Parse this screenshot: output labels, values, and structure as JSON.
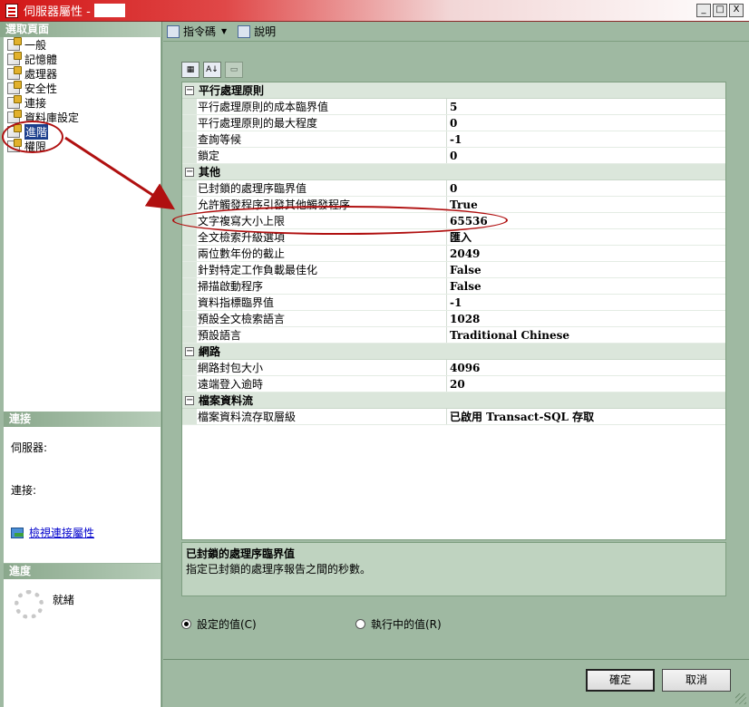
{
  "window": {
    "title": "伺服器屬性 -",
    "buttons": [
      "_",
      "□",
      "X"
    ]
  },
  "left": {
    "select_page_header": "選取頁面",
    "pages": [
      {
        "label": "一般",
        "selected": false
      },
      {
        "label": "記憶體",
        "selected": false
      },
      {
        "label": "處理器",
        "selected": false
      },
      {
        "label": "安全性",
        "selected": false
      },
      {
        "label": "連接",
        "selected": false
      },
      {
        "label": "資料庫設定",
        "selected": false
      },
      {
        "label": "進階",
        "selected": true
      },
      {
        "label": "權限",
        "selected": false
      }
    ],
    "connection_header": "連接",
    "server_label": "伺服器:",
    "connection_label": "連接:",
    "view_conn_link": "檢視連接屬性",
    "progress_header": "進度",
    "progress_status": "就緒"
  },
  "toolbar": {
    "script_label": "指令碼",
    "help_label": "說明"
  },
  "grid_toolbar": {
    "categorized": "▦",
    "alphabetical": "A↓",
    "property_pages": "▭"
  },
  "grid": {
    "categories": [
      {
        "name": "平行處理原則",
        "props": [
          {
            "name": "平行處理原則的成本臨界值",
            "value": "5"
          },
          {
            "name": "平行處理原則的最大程度",
            "value": "0"
          },
          {
            "name": "查詢等候",
            "value": "-1"
          },
          {
            "name": "鎖定",
            "value": "0"
          }
        ]
      },
      {
        "name": "其他",
        "props": [
          {
            "name": "已封鎖的處理序臨界值",
            "value": "0"
          },
          {
            "name": "允許觸發程序引發其他觸發程序",
            "value": "True"
          },
          {
            "name": "文字複寫大小上限",
            "value": "65536"
          },
          {
            "name": "全文檢索升級選項",
            "value": "匯入"
          },
          {
            "name": "兩位數年份的截止",
            "value": "2049"
          },
          {
            "name": "針對特定工作負載最佳化",
            "value": "False"
          },
          {
            "name": "掃描啟動程序",
            "value": "False"
          },
          {
            "name": "資料指標臨界值",
            "value": "-1"
          },
          {
            "name": "預設全文檢索語言",
            "value": "1028"
          },
          {
            "name": "預設語言",
            "value": "Traditional Chinese"
          }
        ]
      },
      {
        "name": "網路",
        "props": [
          {
            "name": "網路封包大小",
            "value": "4096"
          },
          {
            "name": "遠端登入逾時",
            "value": "20"
          }
        ]
      },
      {
        "name": "檔案資料流",
        "props": [
          {
            "name": "檔案資料流存取層級",
            "value": "已啟用 Transact-SQL 存取"
          }
        ]
      }
    ]
  },
  "description": {
    "title": "已封鎖的處理序臨界值",
    "text": "指定已封鎖的處理序報告之間的秒數。"
  },
  "radios": {
    "configured": "設定的值(C)",
    "running": "執行中的值(R)"
  },
  "buttons": {
    "ok": "確定",
    "cancel": "取消"
  },
  "colors": {
    "dialog_bg": "#9fb9a2",
    "title_red": "#d21616",
    "selected_bg": "#1c3f8c",
    "annotation": "#b01010"
  }
}
